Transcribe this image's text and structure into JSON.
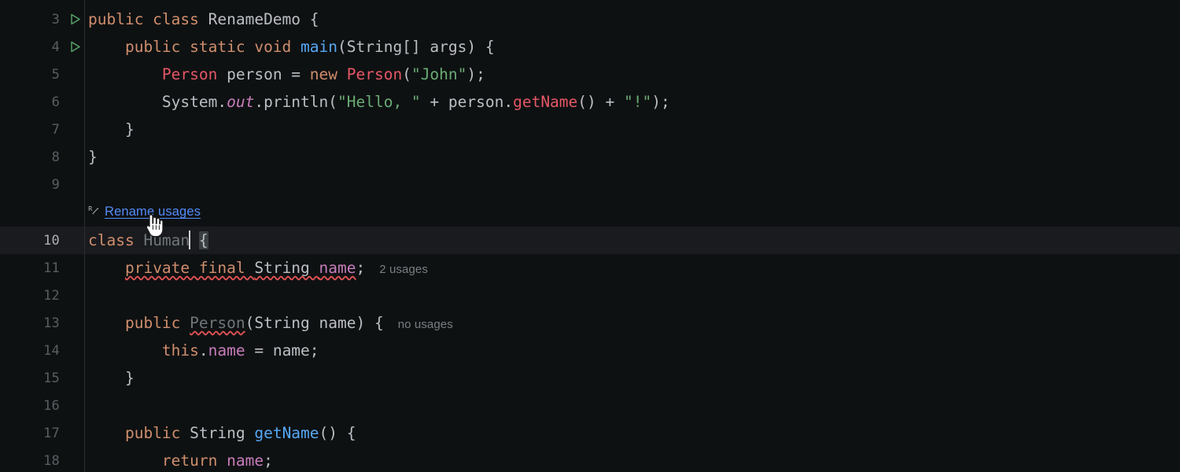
{
  "editor": {
    "theme": "dark",
    "background": "#0e1112",
    "current_line_background": "#1a1b1e",
    "gutter_separator": "#2b2f31",
    "caret_color": "#ced0d6",
    "current_line_number": 10,
    "mouse_cursor": "pointing-hand-cursor"
  },
  "colors": {
    "keyword": "#cf8e6d",
    "identifier": "#bcbec4",
    "string": "#6aab73",
    "method": "#56a8f5",
    "field": "#c77dbb",
    "static_field": "#c77dbb",
    "error": "#e55765",
    "dimmed": "#6f7679",
    "inlay_hint": "#787e82",
    "link": "#548af7",
    "run_marker": "#59a869",
    "error_squiggle": "#e05252",
    "brace_match_background": "#3a3f41"
  },
  "gutter": {
    "lines": [
      {
        "number": "3",
        "run_icon": "run-triangle-icon",
        "current": false
      },
      {
        "number": "4",
        "run_icon": "run-triangle-icon",
        "current": false
      },
      {
        "number": "5",
        "run_icon": null,
        "current": false
      },
      {
        "number": "6",
        "run_icon": null,
        "current": false
      },
      {
        "number": "7",
        "run_icon": null,
        "current": false
      },
      {
        "number": "8",
        "run_icon": null,
        "current": false
      },
      {
        "number": "9",
        "run_icon": null,
        "current": false
      },
      {
        "number": "",
        "run_icon": null,
        "current": false
      },
      {
        "number": "10",
        "run_icon": null,
        "current": true
      },
      {
        "number": "11",
        "run_icon": null,
        "current": false
      },
      {
        "number": "12",
        "run_icon": null,
        "current": false
      },
      {
        "number": "13",
        "run_icon": null,
        "current": false
      },
      {
        "number": "14",
        "run_icon": null,
        "current": false
      },
      {
        "number": "15",
        "run_icon": null,
        "current": false
      },
      {
        "number": "16",
        "run_icon": null,
        "current": false
      },
      {
        "number": "17",
        "run_icon": null,
        "current": false
      },
      {
        "number": "18",
        "run_icon": null,
        "current": false
      }
    ]
  },
  "inlay": {
    "rename_usages": {
      "icon": "rename-refactor-icon",
      "label": "Rename usages"
    },
    "usages_field_name": "2 usages",
    "usages_constructor": "no usages"
  },
  "code": {
    "l3": {
      "t1": "public class ",
      "t2": "RenameDemo",
      "t3": " {"
    },
    "l4": {
      "indent": "    ",
      "t1": "public static void ",
      "t2": "main",
      "t3": "(String[] args) {"
    },
    "l5": {
      "indent": "        ",
      "t1": "Person",
      "t2": " person = ",
      "t3": "new ",
      "t4": "Person",
      "t5": "(",
      "t6": "\"John\"",
      "t7": ");"
    },
    "l6": {
      "indent": "        ",
      "t1": "System.",
      "t2": "out",
      "t3": ".println(",
      "t4": "\"Hello, \"",
      "t5": " + person.",
      "t6": "getName",
      "t7": "() + ",
      "t8": "\"!\"",
      "t9": ");"
    },
    "l7": {
      "text": "    }"
    },
    "l8": {
      "text": "}"
    },
    "l9": {
      "text": ""
    },
    "l10": {
      "t1": "class ",
      "t2": "Human",
      "t3": " ",
      "t4": "{"
    },
    "l11": {
      "indent": "    ",
      "t1": "private final ",
      "t2": "String ",
      "t3": "name",
      "t4": ";"
    },
    "l12": {
      "text": ""
    },
    "l13": {
      "indent": "    ",
      "t1": "public ",
      "t2": "Person",
      "t3": "(String name) {"
    },
    "l14": {
      "indent": "        ",
      "t1": "this",
      "t2": ".",
      "t3": "name",
      "t4": " = name;"
    },
    "l15": {
      "text": "    }"
    },
    "l16": {
      "text": ""
    },
    "l17": {
      "indent": "    ",
      "t1": "public ",
      "t2": "String ",
      "t3": "getName",
      "t4": "() {"
    },
    "l18": {
      "indent": "        ",
      "t1": "return ",
      "t2": "name",
      "t3": ";"
    }
  }
}
